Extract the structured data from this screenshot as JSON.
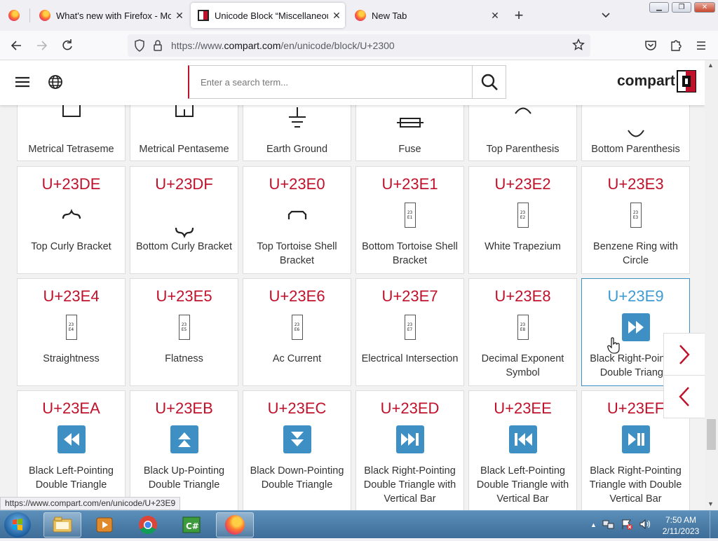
{
  "browser": {
    "tabs": [
      {
        "title": "What's new with Firefox - More"
      },
      {
        "title": "Unicode Block “Miscellaneous T"
      },
      {
        "title": "New Tab"
      }
    ],
    "new_tab_label": "+",
    "url_prefix": "https://www.",
    "url_domain": "compart.com",
    "url_path": "/en/unicode/block/U+2300"
  },
  "site": {
    "search_placeholder": "Enter a search term...",
    "logo_text": "compart"
  },
  "row_top": [
    {
      "name": "Metrical Tetraseme"
    },
    {
      "name": "Metrical Pentaseme"
    },
    {
      "name": "Earth Ground"
    },
    {
      "name": "Fuse"
    },
    {
      "name": "Top Parenthesis"
    },
    {
      "name": "Bottom Parenthesis"
    }
  ],
  "row_a": [
    {
      "code": "U+23DE",
      "name": "Top Curly Bracket"
    },
    {
      "code": "U+23DF",
      "name": "Bottom Curly Bracket"
    },
    {
      "code": "U+23E0",
      "name": "Top Tortoise Shell Bracket"
    },
    {
      "code": "U+23E1",
      "name": "Bottom Tortoise Shell Bracket",
      "glyph": "23\nE1"
    },
    {
      "code": "U+23E2",
      "name": "White Trapezium",
      "glyph": "23\nE2"
    },
    {
      "code": "U+23E3",
      "name": "Benzene Ring with Circle",
      "glyph": "23\nE3"
    }
  ],
  "row_b": [
    {
      "code": "U+23E4",
      "name": "Straightness",
      "glyph": "23\nE4"
    },
    {
      "code": "U+23E5",
      "name": "Flatness",
      "glyph": "23\nE5"
    },
    {
      "code": "U+23E6",
      "name": "Ac Current",
      "glyph": "23\nE6"
    },
    {
      "code": "U+23E7",
      "name": "Electrical Intersection",
      "glyph": "23\nE7"
    },
    {
      "code": "U+23E8",
      "name": "Decimal Exponent Symbol",
      "glyph": "23\nE8"
    },
    {
      "code": "U+23E9",
      "name": "Black Right-Pointing Double Triangle"
    }
  ],
  "row_c": [
    {
      "code": "U+23EA",
      "name": "Black Left-Pointing Double Triangle"
    },
    {
      "code": "U+23EB",
      "name": "Black Up-Pointing Double Triangle"
    },
    {
      "code": "U+23EC",
      "name": "Black Down-Pointing Double Triangle"
    },
    {
      "code": "U+23ED",
      "name": "Black Right-Pointing Double Triangle with Vertical Bar"
    },
    {
      "code": "U+23EE",
      "name": "Black Left-Pointing Double Triangle with Vertical Bar"
    },
    {
      "code": "U+23EF",
      "name": "Black Right-Pointing Triangle with Double Vertical Bar"
    }
  ],
  "status_url": "https://www.compart.com/en/unicode/U+23E9",
  "clock": {
    "time": "7:50 AM",
    "date": "2/11/2023"
  },
  "colors": {
    "code_red": "#c0112b",
    "highlight_blue": "#3d9bd1",
    "icon_blue": "#3d8fc4"
  }
}
